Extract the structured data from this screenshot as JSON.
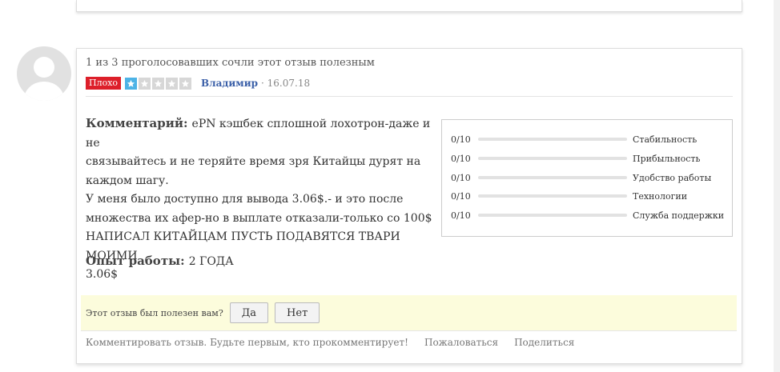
{
  "review": {
    "helpful_count_text": "1 из 3 проголосовавших сочли этот отзыв полезным",
    "verdict_badge": "Плохо",
    "stars": {
      "filled": 1,
      "total": 5
    },
    "author": "Владимир",
    "date": "· 16.07.18",
    "comment_label": "Комментарий:",
    "comment_lines": [
      "ePN кэшбек сплошной лохотрон-даже и не",
      "связывайтесь и не теряйте время зря Китайцы дурят на",
      "каждом шагу.",
      "У меня было доступно для вывода 3.06$.- и это после",
      "множества их афер-но в выплате отказали-только со 100$",
      "НАПИСАЛ КИТАЙЦАМ ПУСТЬ ПОДАВЯТСЯ ТВАРИ МОИМИ",
      "3.06$"
    ],
    "experience_label": "Опыт работы:",
    "experience_value": "2 ГОДА"
  },
  "ratings": [
    {
      "score": "0/10",
      "name": "Стабильность",
      "value": 0
    },
    {
      "score": "0/10",
      "name": "Прибыльность",
      "value": 0
    },
    {
      "score": "0/10",
      "name": "Удобство работы",
      "value": 0
    },
    {
      "score": "0/10",
      "name": "Технологии",
      "value": 0
    },
    {
      "score": "0/10",
      "name": "Служба поддержки",
      "value": 0
    }
  ],
  "helpful_prompt": {
    "question": "Этот отзыв был полезен вам?",
    "yes_label": "Да",
    "no_label": "Нет"
  },
  "footer": {
    "comment_link": "Комментировать отзыв. Будьте первым, кто прокомментирует!",
    "report_link": "Пожаловаться",
    "share_link": "Поделиться"
  },
  "colors": {
    "badge": "#dd1f2a",
    "star_filled": "#4db3e6",
    "star_empty": "#d7d7d7",
    "author": "#3a5fa8",
    "helpful_bg": "#fcfcdc"
  },
  "icons": {
    "avatar": "user-silhouette-icon",
    "star": "star-icon"
  }
}
